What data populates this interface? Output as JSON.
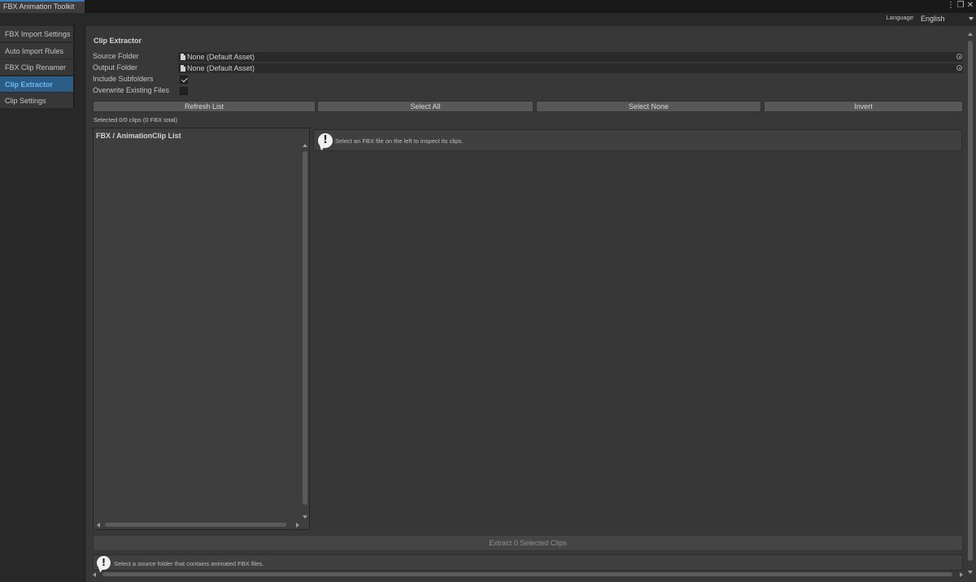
{
  "window": {
    "tab_title": "FBX Animation Toolkit",
    "menu_icon": "kebab-menu-icon",
    "maximize_icon": "maximize-icon",
    "close_icon": "close-icon"
  },
  "language": {
    "label": "Language",
    "selected": "English"
  },
  "sidebar": {
    "items": [
      {
        "label": "FBX Import Settings"
      },
      {
        "label": "Auto Import Rules"
      },
      {
        "label": "FBX Clip Renamer"
      },
      {
        "label": "Clip Extractor",
        "active": true
      },
      {
        "label": "Clip Settings"
      }
    ]
  },
  "main": {
    "header": "Clip Extractor",
    "source_folder": {
      "label": "Source Folder",
      "value": "None (Default Asset)"
    },
    "output_folder": {
      "label": "Output Folder",
      "value": "None (Default Asset)"
    },
    "include_subfolders": {
      "label": "Include Subfolders",
      "checked": true
    },
    "overwrite_existing": {
      "label": "Overwrite Existing Files",
      "checked": false
    },
    "buttons": {
      "refresh": "Refresh List",
      "select_all": "Select All",
      "select_none": "Select None",
      "invert": "Invert"
    },
    "status": "Selected 0/0 clips (0 FBX total)",
    "list": {
      "title": "FBX / AnimationClip List"
    },
    "detail_hint": "Select an FBX file on the left to inspect its clips.",
    "extract_button": "Extract 0 Selected Clips",
    "footer_hint": "Select a source folder that contains animated FBX files."
  },
  "colors": {
    "accent_tab": "#3a79bb",
    "active_item_bg": "#2c5d87",
    "active_item_text": "#6ab8f2",
    "panel_bg": "#383838",
    "window_bg": "#282828"
  }
}
